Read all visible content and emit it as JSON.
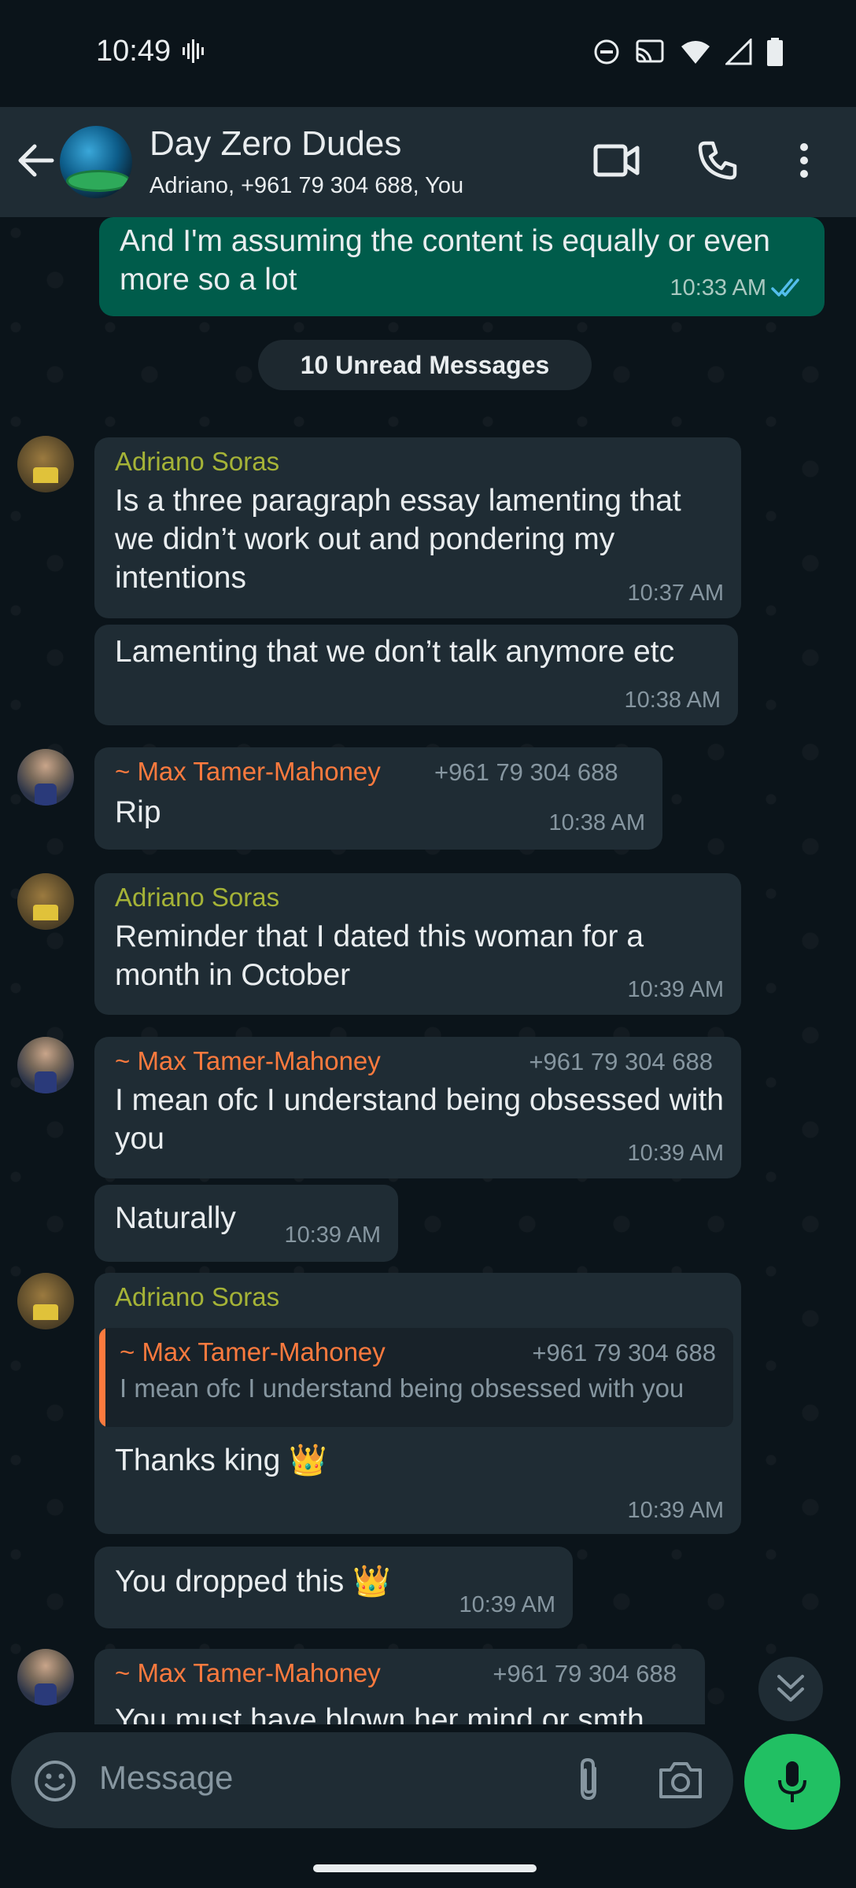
{
  "status_bar": {
    "time": "10:49"
  },
  "header": {
    "title": "Day Zero Dudes",
    "subtitle": "Adriano, +961 79 304 688, You"
  },
  "chat": {
    "unread_label": "10 Unread Messages",
    "messages": [
      {
        "from": "You",
        "text": "And I'm assuming the content is equally or even more so a lot",
        "time": "10:33 AM",
        "status": "read"
      },
      {
        "sender": "Adriano Soras",
        "text": "Is a three paragraph essay lamenting that we didn’t work out and pondering my intentions",
        "time": "10:37 AM"
      },
      {
        "text": "Lamenting that we don’t talk anymore etc",
        "time": "10:38 AM"
      },
      {
        "sender": "~ Max Tamer-Mahoney",
        "phone": "+961 79 304 688",
        "text": "Rip",
        "time": "10:38 AM"
      },
      {
        "sender": "Adriano Soras",
        "text": "Reminder that I dated this woman for a month in October",
        "time": "10:39 AM"
      },
      {
        "sender": "~ Max Tamer-Mahoney",
        "phone": "+961 79 304 688",
        "text": "I mean ofc I understand being obsessed with you",
        "time": "10:39 AM"
      },
      {
        "text": "Naturally",
        "time": "10:39 AM"
      },
      {
        "sender": "Adriano Soras",
        "quote": {
          "sender": "~ Max Tamer-Mahoney",
          "phone": "+961 79 304 688",
          "text": "I mean ofc I understand being obsessed with you"
        },
        "text": "Thanks king 👑",
        "time": "10:39 AM"
      },
      {
        "text": "You dropped this 👑",
        "time": "10:39 AM"
      },
      {
        "sender": "~ Max Tamer-Mahoney",
        "phone": "+961 79 304 688",
        "text": "You must have blown her mind or smth"
      }
    ]
  },
  "composer": {
    "placeholder": "Message"
  },
  "colors": {
    "accent_green": "#21c063",
    "outgoing_bubble": "#005c4b",
    "incoming_bubble": "#1f2c34",
    "sender_adriano": "#a5b337",
    "sender_max": "#fc7a3e"
  }
}
